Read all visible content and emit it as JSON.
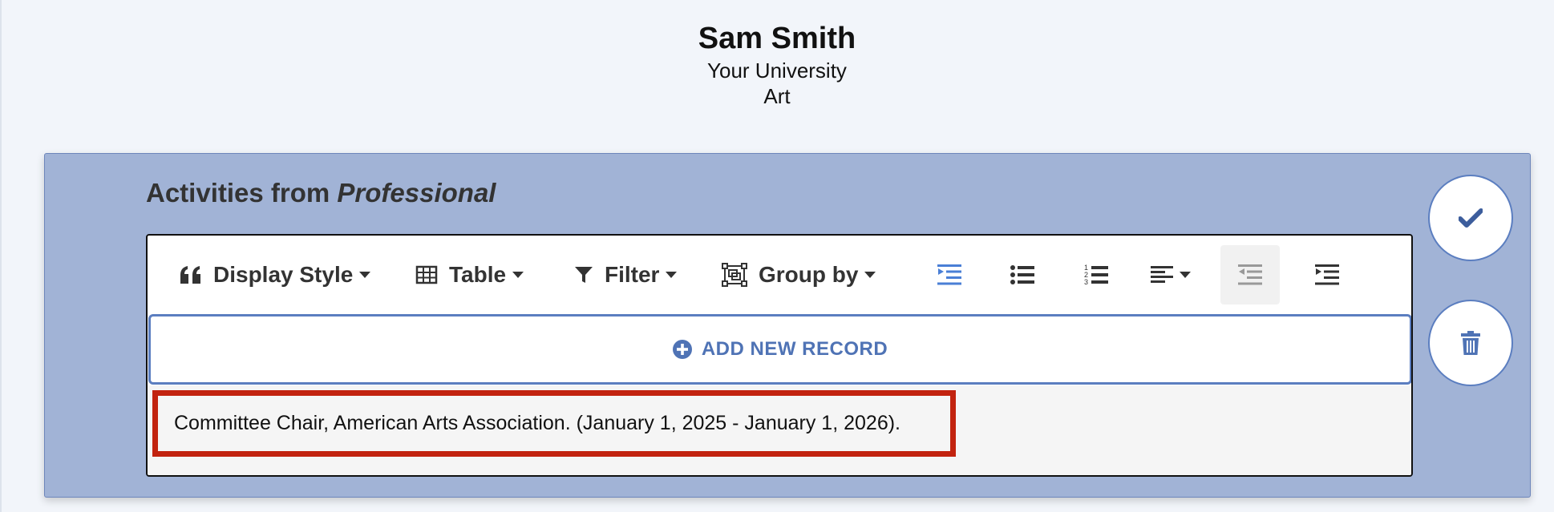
{
  "profile": {
    "name": "Sam Smith",
    "institution": "Your University",
    "department": "Art"
  },
  "panel": {
    "title_prefix": "Activities from ",
    "title_section": "Professional"
  },
  "toolbar": {
    "display_style_label": "Display Style",
    "table_label": "Table",
    "filter_label": "Filter",
    "group_by_label": "Group by",
    "icons": [
      "quote-icon",
      "table-icon",
      "filter-icon",
      "group-by-icon",
      "indent-active-icon",
      "bullet-list-icon",
      "numbered-list-icon",
      "align-left-icon",
      "outdent-icon",
      "indent-icon"
    ],
    "accent_color": "#4a7fd6"
  },
  "add_record": {
    "label": "ADD NEW RECORD"
  },
  "records": [
    {
      "text": "Committee Chair, American Arts Association. (January 1, 2025 - January 1, 2026)."
    }
  ],
  "colors": {
    "panel_bg": "#a1b3d6",
    "highlight_border": "#c2230f",
    "brand_blue": "#4f73b5"
  }
}
